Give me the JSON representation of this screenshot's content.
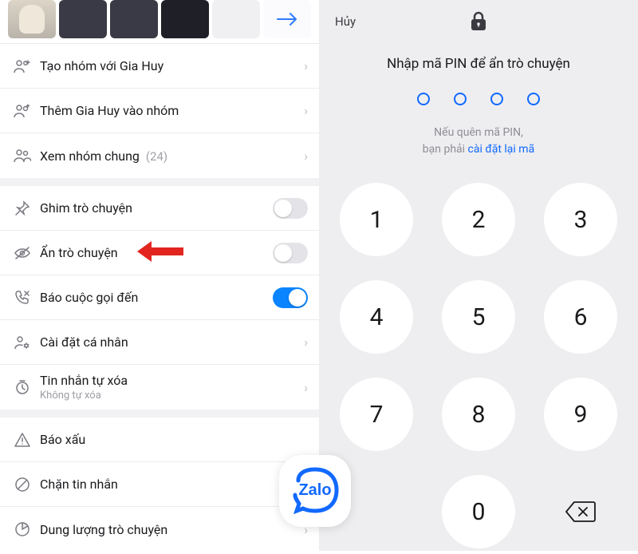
{
  "left": {
    "rows": {
      "create_group": "Tạo nhóm với Gia Huy",
      "add_to_group": "Thêm Gia Huy vào nhóm",
      "view_groups": "Xem nhóm chung",
      "view_groups_count": "(24)",
      "pin_chat": "Ghim trò chuyện",
      "hide_chat": "Ẩn trò chuyện",
      "call_notify": "Báo cuộc gọi đến",
      "personal_settings": "Cài đặt cá nhân",
      "auto_delete": "Tin nhắn tự xóa",
      "auto_delete_sub": "Không tự xóa",
      "report": "Báo xấu",
      "block": "Chặn tin nhắn",
      "storage": "Dung lượng trò chuyện"
    },
    "brand": "Zalo"
  },
  "right": {
    "cancel": "Hủy",
    "title": "Nhập mã PIN để ẩn trò chuyện",
    "forgot_line1": "Nếu quên mã PIN,",
    "forgot_line2_pre": "bạn phải ",
    "forgot_link": "cài đặt lại mã",
    "keys": {
      "k1": "1",
      "k2": "2",
      "k3": "3",
      "k4": "4",
      "k5": "5",
      "k6": "6",
      "k7": "7",
      "k8": "8",
      "k9": "9",
      "k0": "0",
      "del": "✕"
    }
  }
}
